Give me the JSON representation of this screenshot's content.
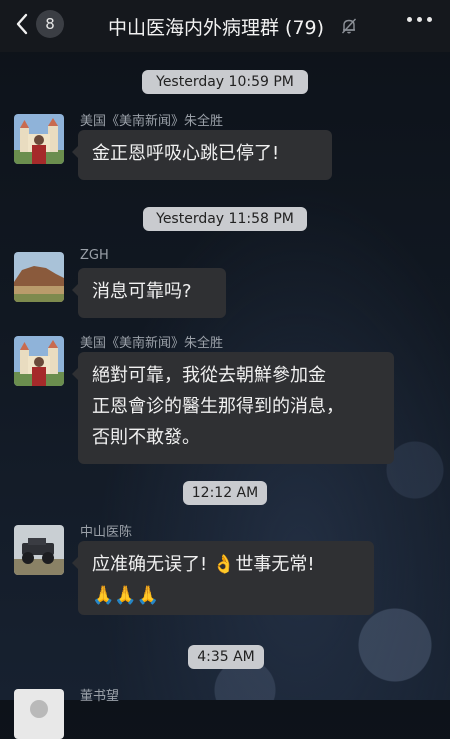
{
  "header": {
    "back_count": "8",
    "title": "中山医海内外病理群 (79)"
  },
  "timestamps": [
    "Yesterday 10:59 PM",
    "Yesterday 11:58 PM",
    "12:12 AM",
    "4:35 AM"
  ],
  "messages": [
    {
      "sender": "美国《美南新闻》朱全胜",
      "lines": [
        "金正恩呼吸心跳已停了!"
      ],
      "avatar": "castle-photo-avatar"
    },
    {
      "sender": "ZGH",
      "lines": [
        "消息可靠吗?"
      ],
      "avatar": "landscape-photo-avatar"
    },
    {
      "sender": "美国《美南新闻》朱全胜",
      "lines": [
        "絕對可靠，我從去朝鮮參加金",
        "正恩會诊的醫生那得到的消息，",
        "否則不敢發。"
      ],
      "avatar": "castle-photo-avatar"
    },
    {
      "sender": "中山医陈",
      "lines": [
        "应准确无误了! 👌世事无常!",
        "🙏🙏🙏"
      ],
      "avatar": "vehicle-photo-avatar"
    },
    {
      "sender": "董书望",
      "lines": [],
      "avatar": "profile-avatar"
    }
  ],
  "icons": {
    "back": "chevron-left-icon",
    "mute": "bell-muted-icon",
    "more": "more-dots-icon"
  },
  "colors": {
    "header_bg": "#15181d",
    "bubble_bg": "#2f3033",
    "timestamp_bg": "#c9cbcf",
    "sender_text": "#9aa0a8"
  }
}
